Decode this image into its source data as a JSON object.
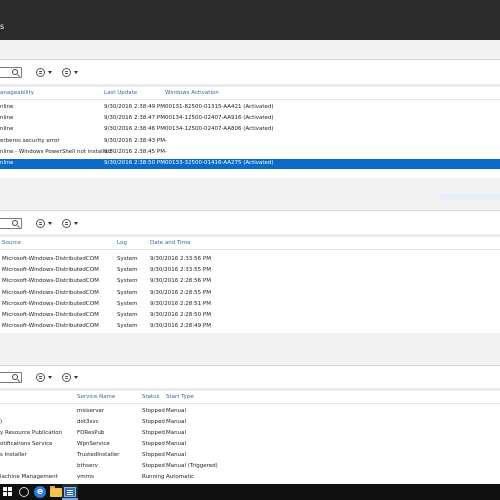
{
  "window": {
    "title": "s"
  },
  "servers": {
    "columns": [
      "anageability",
      "Last Update",
      "Windows Activation"
    ],
    "rows": [
      {
        "manageability": "nline",
        "last_update": "9/30/2016 2:38:49 PM",
        "activation": "00131-82500-01315-AA421 (Activated)",
        "selected": false
      },
      {
        "manageability": "nline",
        "last_update": "9/30/2016 2:38:47 PM",
        "activation": "00134-12500-02407-AA916 (Activated)",
        "selected": false
      },
      {
        "manageability": "nline",
        "last_update": "9/30/2016 2:38:46 PM",
        "activation": "00134-12500-02407-AA806 (Activated)",
        "selected": false
      },
      {
        "manageability": "erberos security error",
        "last_update": "9/30/2016 2:38:43 PM",
        "activation": "-",
        "selected": false
      },
      {
        "manageability": "nline - Windows PowerShell not installed",
        "last_update": "9/30/2016 2:38:45 PM",
        "activation": "-",
        "selected": false
      },
      {
        "manageability": "nline",
        "last_update": "9/30/2016 2:38:50 PM",
        "activation": "00133-32500-01416-AA275 (Activated)",
        "selected": true
      }
    ]
  },
  "events": {
    "columns": [
      "Source",
      "Log",
      "Date and Time"
    ],
    "rows": [
      {
        "source": "Microsoft-Windows-DistributedCOM",
        "log": "System",
        "date": "9/30/2016 2:33:56 PM"
      },
      {
        "source": "Microsoft-Windows-DistributedCOM",
        "log": "System",
        "date": "9/30/2016 2:33:55 PM"
      },
      {
        "source": "Microsoft-Windows-DistributedCOM",
        "log": "System",
        "date": "9/30/2016 2:28:56 PM"
      },
      {
        "source": "Microsoft-Windows-DistributedCOM",
        "log": "System",
        "date": "9/30/2016 2:28:55 PM"
      },
      {
        "source": "Microsoft-Windows-DistributedCOM",
        "log": "System",
        "date": "9/30/2016 2:28:51 PM"
      },
      {
        "source": "Microsoft-Windows-DistributedCOM",
        "log": "System",
        "date": "9/30/2016 2:28:50 PM"
      },
      {
        "source": "Microsoft-Windows-DistributedCOM",
        "log": "System",
        "date": "9/30/2016 2:28:49 PM"
      }
    ]
  },
  "services": {
    "columns": [
      "Service Name",
      "Status",
      "Start Type"
    ],
    "rows": [
      {
        "display": "",
        "name": "msiserver",
        "status": "Stopped",
        "start": "Manual"
      },
      {
        "display": ")",
        "name": "dot3svc",
        "status": "Stopped",
        "start": "Manual"
      },
      {
        "display": "y Resource Publication",
        "name": "FDResPub",
        "status": "Stopped",
        "start": "Manual"
      },
      {
        "display": "otifications Service",
        "name": "WpnService",
        "status": "Stopped",
        "start": "Manual"
      },
      {
        "display": "s Installer",
        "name": "TrustedInstaller",
        "status": "Stopped",
        "start": "Manual"
      },
      {
        "display": "",
        "name": "bthserv",
        "status": "Stopped",
        "start": "Manual (Triggered)"
      },
      {
        "display": "lachine Management",
        "name": "vmms",
        "status": "Running",
        "start": "Automatic"
      }
    ]
  },
  "taskbar": {
    "items": [
      "start-icon",
      "cortana-icon",
      "internet-explorer-icon",
      "file-explorer-icon",
      "server-manager-icon"
    ],
    "ie_glyph": "e"
  },
  "colors": {
    "selection": "#0a6bc9",
    "header_text": "#3465a4",
    "titlebar": "#2b2b2b",
    "taskbar": "#101010"
  }
}
